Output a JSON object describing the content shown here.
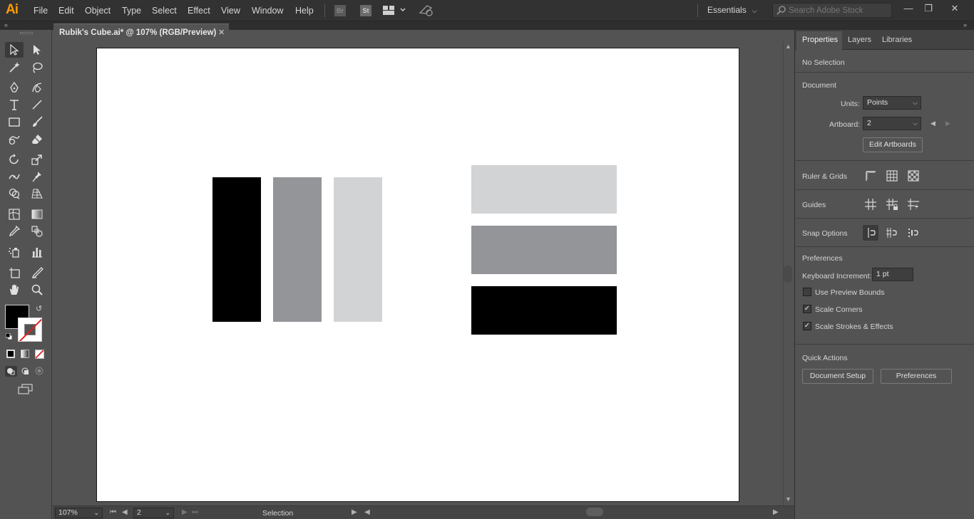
{
  "app": {
    "logo": "Ai",
    "menus": [
      "File",
      "Edit",
      "Object",
      "Type",
      "Select",
      "Effect",
      "View",
      "Window",
      "Help"
    ],
    "bridge_badge": "Br",
    "stock_badge": "St",
    "workspace": "Essentials",
    "search_placeholder": "Search Adobe Stock"
  },
  "document": {
    "tab_title": "Rubik's Cube.ai* @ 107% (RGB/Preview)",
    "close_glyph": "✕"
  },
  "artboard_shapes": {
    "left_group": [
      "#000000",
      "#939598",
      "#d1d3d4"
    ],
    "right_group": [
      "#d1d3d4",
      "#939598",
      "#000000"
    ]
  },
  "status": {
    "zoom": "107%",
    "artboard_number": "2",
    "tool_name": "Selection"
  },
  "panel": {
    "tabs": [
      "Properties",
      "Layers",
      "Libraries"
    ],
    "selection": "No Selection",
    "document_title": "Document",
    "units_label": "Units:",
    "units_value": "Points",
    "artboard_label": "Artboard:",
    "artboard_value": "2",
    "edit_artboards": "Edit Artboards",
    "ruler_grids": "Ruler & Grids",
    "guides": "Guides",
    "snap_options": "Snap Options",
    "preferences_title": "Preferences",
    "keyboard_increment_label": "Keyboard Increment:",
    "keyboard_increment_value": "1 pt",
    "use_preview_bounds": "Use Preview Bounds",
    "use_preview_bounds_checked": false,
    "scale_corners": "Scale Corners",
    "scale_corners_checked": true,
    "scale_strokes": "Scale Strokes & Effects",
    "scale_strokes_checked": true,
    "quick_actions": "Quick Actions",
    "document_setup": "Document Setup",
    "preferences_button": "Preferences"
  },
  "colors": {
    "accent_logo": "#ff9a00",
    "fill": "#000000",
    "stroke_none": "#e02020"
  }
}
